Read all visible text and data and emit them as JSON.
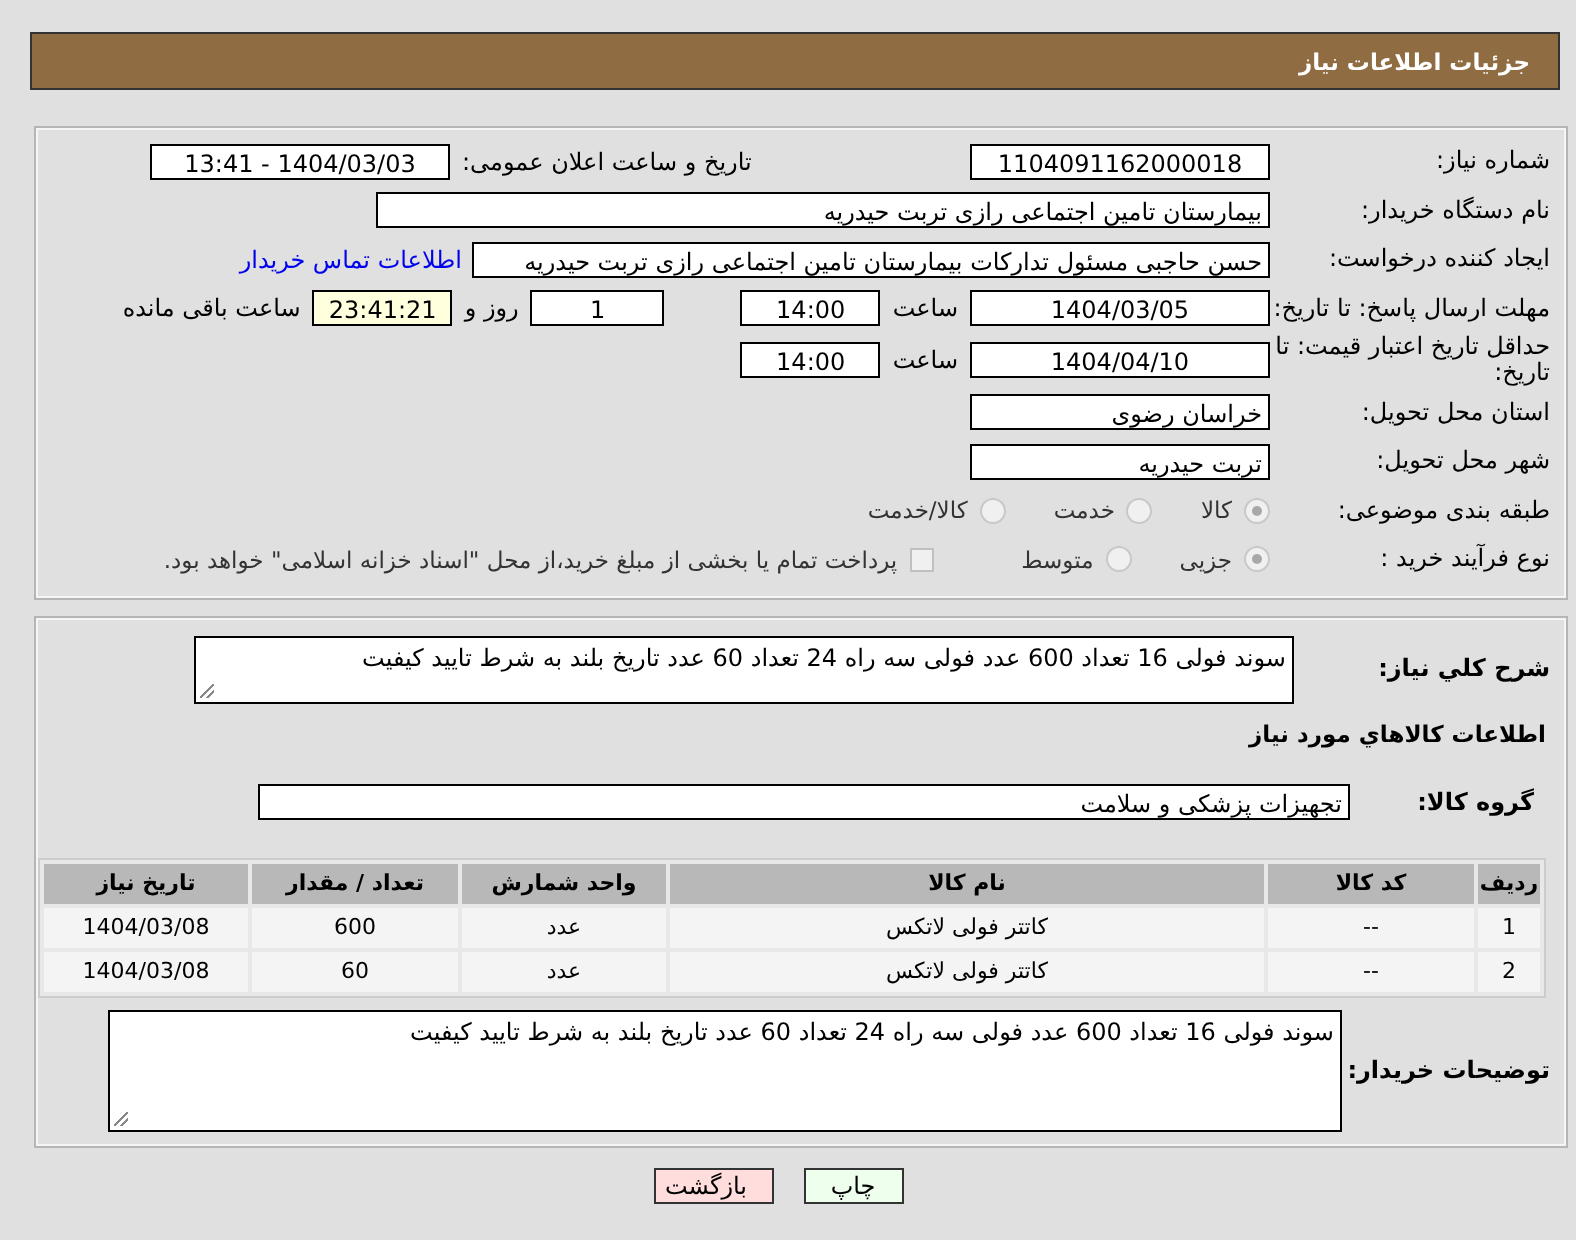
{
  "header": {
    "title": "جزئیات اطلاعات نیاز"
  },
  "need_number": {
    "label": "شماره نیاز:",
    "value": "1104091162000018"
  },
  "announce": {
    "label": "تاریخ و ساعت اعلان عمومی:",
    "value": "1404/03/03 - 13:41"
  },
  "buyer_org": {
    "label": "نام دستگاه خریدار:",
    "value": "بیمارستان تامین اجتماعی رازی تربت حیدریه"
  },
  "requester": {
    "label": "ایجاد کننده درخواست:",
    "value": "حسن حاجبی مسئول تدارکات بیمارستان تامین اجتماعی رازی تربت حیدریه",
    "link": "اطلاعات تماس خریدار"
  },
  "deadline": {
    "label": "مهلت ارسال پاسخ: تا تاریخ:",
    "date": "1404/03/05",
    "time_label": "ساعت",
    "time": "14:00",
    "days": "1",
    "days_label": "روز و",
    "remaining": "23:41:21",
    "remaining_label": "ساعت باقی مانده"
  },
  "validity": {
    "label": "حداقل تاریخ اعتبار قیمت: تا تاریخ:",
    "date": "1404/04/10",
    "time_label": "ساعت",
    "time": "14:00"
  },
  "province": {
    "label": "استان محل تحویل:",
    "value": "خراسان رضوی"
  },
  "city": {
    "label": "شهر محل تحویل:",
    "value": "تربت حیدریه"
  },
  "category": {
    "label": "طبقه بندی موضوعی:",
    "options": [
      {
        "label": "کالا",
        "selected": true
      },
      {
        "label": "خدمت",
        "selected": false
      },
      {
        "label": "کالا/خدمت",
        "selected": false
      }
    ]
  },
  "process": {
    "label": "نوع فرآیند خرید :",
    "options": [
      {
        "label": "جزیی",
        "selected": true
      },
      {
        "label": "متوسط",
        "selected": false
      }
    ],
    "payment": {
      "checked": false,
      "text": "پرداخت تمام یا بخشی از مبلغ خرید،از محل \"اسناد خزانه اسلامی\" خواهد بود."
    }
  },
  "description": {
    "label": "شرح کلي نياز:",
    "value": "سوند فولی 16 تعداد 600 عدد فولی سه راه 24  تعداد 60 عدد تاریخ بلند به شرط تایید کیفیت"
  },
  "items_title": "اطلاعات کالاهاي مورد نياز",
  "goods_group": {
    "label": "گروه کالا:",
    "value": "تجهیزات پزشکی و سلامت"
  },
  "table": {
    "columns": [
      "ردیف",
      "کد کالا",
      "نام کالا",
      "واحد شمارش",
      "تعداد / مقدار",
      "تاریخ نیاز"
    ],
    "rows": [
      [
        "1",
        "--",
        "کاتتر فولی لاتکس",
        "عدد",
        "600",
        "1404/03/08"
      ],
      [
        "2",
        "--",
        "کاتتر فولی لاتکس",
        "عدد",
        "60",
        "1404/03/08"
      ]
    ]
  },
  "buyer_notes": {
    "label": "توضیحات خریدار:",
    "value": "سوند فولی 16 تعداد 600 عدد فولی سه راه 24  تعداد 60 عدد تاریخ بلند به شرط تایید کیفیت"
  },
  "buttons": [
    {
      "kind": "print",
      "label": "چاپ"
    },
    {
      "kind": "back",
      "label": "بازگشت"
    }
  ]
}
